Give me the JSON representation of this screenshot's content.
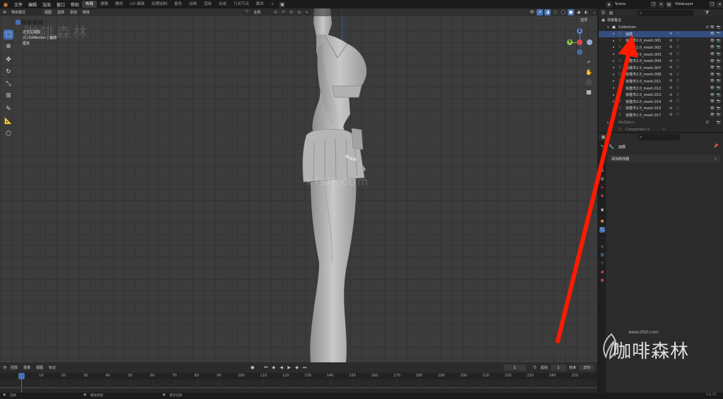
{
  "topbar": {
    "menus": [
      "文件",
      "编辑",
      "渲染",
      "窗口",
      "帮助"
    ],
    "workspaces": [
      "布局",
      "建模",
      "雕刻",
      "UV 编辑",
      "纹理绘制",
      "着色",
      "动画",
      "渲染",
      "合成",
      "几何节点",
      "脚本"
    ],
    "active_workspace": 0,
    "add_tab": "+",
    "scene_label": "Scene",
    "viewlayer_label": "ViewLayer"
  },
  "viewport_header": {
    "mode": "物体模式",
    "menus": [
      "视图",
      "选择",
      "添加",
      "物体"
    ],
    "transform": "全局",
    "options": "选项"
  },
  "viewport_overlay": {
    "view_name": "正交左视图",
    "collection_info": "(1) Collection | 面膜",
    "units": "厘米",
    "watermark_text": "咖啡森林",
    "site_watermark": "kfsll.com"
  },
  "gizmo": {
    "z": "Z",
    "y": "Y",
    "x": "X"
  },
  "timeline_header": {
    "menus": [
      "回放",
      "抠像",
      "视图",
      "标记"
    ],
    "current_frame": "1",
    "start_label": "起始",
    "start_value": "1",
    "end_label": "结束",
    "end_value": "250"
  },
  "timeline": {
    "ticks": [
      "1",
      "10",
      "20",
      "30",
      "40",
      "50",
      "60",
      "70",
      "80",
      "90",
      "100",
      "110",
      "120",
      "130",
      "140",
      "150",
      "160",
      "170",
      "180",
      "190",
      "200",
      "210",
      "220",
      "230",
      "240",
      "250"
    ]
  },
  "statusbar": {
    "left": "选择",
    "middle": "播放视图",
    "right": "菱形选择",
    "version": "3.6.15"
  },
  "outliner": {
    "root": "场景集合",
    "collection": "Collection",
    "rows": [
      {
        "name": "面膜",
        "selected": true
      },
      {
        "name": "坂隆市2.0_mesh.001"
      },
      {
        "name": "坂隆市2.0_mesh.002"
      },
      {
        "name": "坂隆市2.0_mesh.003"
      },
      {
        "name": "坂隆市2.0_mesh.004"
      },
      {
        "name": "坂隆市2.0_mesh.007"
      },
      {
        "name": "坂隆市2.0_mesh.008"
      },
      {
        "name": "坂隆市2.0_mesh.011"
      },
      {
        "name": "坂隆市2.0_mesh.012"
      },
      {
        "name": "坂隆市2.0_mesh.013"
      },
      {
        "name": "坂隆市2.0_mesh.014"
      },
      {
        "name": "坂隆市2.0_mesh.015"
      },
      {
        "name": "坂隆市2.0_mesh.017"
      }
    ],
    "sub_collection": "Aa2bJecs",
    "component": "Component 0"
  },
  "properties": {
    "object_name": "面膜",
    "add_modifier": "添加修改器"
  },
  "brand_watermark": {
    "url": "www.kfsll.com",
    "title": "咖啡森林"
  },
  "colors": {
    "accent": "#4772b3",
    "arrow": "#ff1a00",
    "mesh_orange": "#e8852f",
    "mesh_green": "#5ec88a"
  }
}
